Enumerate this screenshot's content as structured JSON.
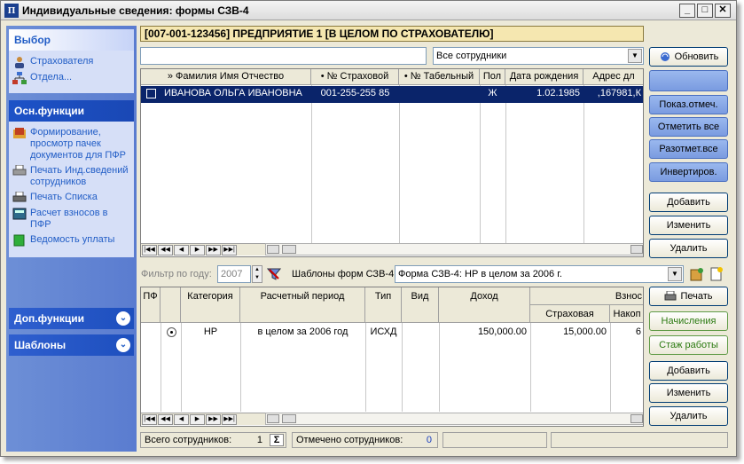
{
  "window": {
    "title": "Индивидуальные сведения: формы СЗВ-4",
    "icon": "П"
  },
  "sidebar": {
    "section1": {
      "title": "Выбор",
      "items": [
        {
          "label": "Страхователя"
        },
        {
          "label": "Отдела..."
        }
      ]
    },
    "section2": {
      "title": "Осн.функции",
      "items": [
        {
          "label": "Формирование, просмотр пачек документов для ПФР"
        },
        {
          "label": "Печать Инд.сведений сотрудников"
        },
        {
          "label": "Печать Списка"
        },
        {
          "label": "Расчет взносов в ПФР"
        },
        {
          "label": "Ведомость уплаты"
        }
      ]
    },
    "section3": {
      "title": "Доп.функции"
    },
    "section4": {
      "title": "Шаблоны"
    }
  },
  "banner": "[007-001-123456] ПРЕДПРИЯТИЕ 1 [В ЦЕЛОМ ПО СТРАХОВАТЕЛЮ]",
  "employee_filter": {
    "search_value": "",
    "dropdown_value": "Все сотрудники"
  },
  "employees": {
    "columns": [
      "» Фамилия Имя Отчество",
      "• № Страховой",
      "• № Табельный",
      "Пол",
      "Дата рождения",
      "Адрес дл"
    ],
    "rows": [
      {
        "name": "ИВАНОВА ОЛЬГА ИВАНОВНА",
        "insurance": "001-255-255 85",
        "tab": "",
        "sex": "Ж",
        "birth": "1.02.1985",
        "address": ",167981,К"
      }
    ]
  },
  "right_buttons_top": {
    "refresh": "Обновить",
    "show_marked": "Показ.отмеч.",
    "mark_all": "Отметить все",
    "unmark_all": "Разотмет.все",
    "invert": "Инвертиров.",
    "add": "Добавить",
    "edit": "Изменить",
    "delete": "Удалить"
  },
  "year_filter": {
    "label": "Фильтр по году:",
    "value": "2007"
  },
  "templates": {
    "label": "Шаблоны форм СЗВ-4:",
    "value": "Форма СЗВ-4: НР в целом за 2006 г."
  },
  "forms": {
    "columns": [
      "ПФ",
      "Категория",
      "Расчетный период",
      "Тип",
      "Вид",
      "Доход",
      "Взнос"
    ],
    "subcolumns": [
      "Страховая",
      "Накоп"
    ],
    "rows": [
      {
        "category": "НР",
        "period": "в целом за 2006 год",
        "type": "ИСХД",
        "kind": "",
        "income": "150,000.00",
        "insurance": "15,000.00",
        "funded": "6"
      }
    ]
  },
  "right_buttons_bottom": {
    "print": "Печать",
    "accruals": "Начисления",
    "experience": "Стаж работы",
    "add": "Добавить",
    "edit": "Изменить",
    "delete": "Удалить"
  },
  "status": {
    "total_label": "Всего сотрудников:",
    "total_value": "1",
    "marked_label": "Отмечено сотрудников:",
    "marked_value": "0"
  }
}
